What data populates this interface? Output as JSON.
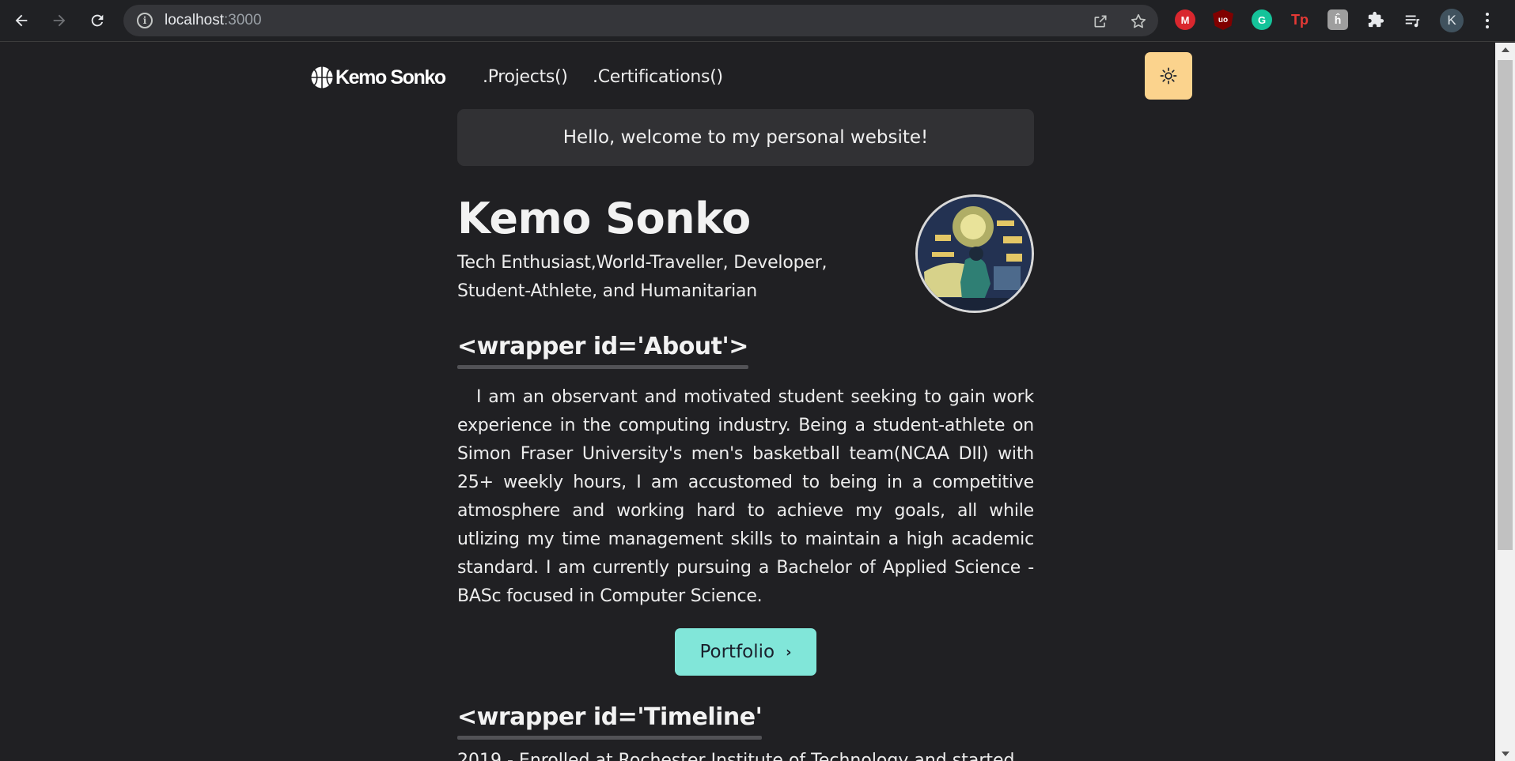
{
  "browser": {
    "url_host": "localhost",
    "url_port": ":3000",
    "profile_initial": "K",
    "extensions": [
      {
        "icon": "mega-icon",
        "label": "M",
        "color": "#d9272e"
      },
      {
        "icon": "ublock-icon",
        "label": "uo",
        "color": "#800000"
      },
      {
        "icon": "grammarly-icon",
        "label": "G",
        "color": "#15c39a"
      },
      {
        "icon": "tp-icon",
        "label": "Tp",
        "color": "#e53935"
      },
      {
        "icon": "lock-extension-icon",
        "label": "ĥ",
        "color": "#9e9e9e"
      }
    ]
  },
  "header": {
    "logo_text": "Kemo Sonko",
    "nav": [
      ".Projects()",
      ".Certifications()"
    ],
    "theme_toggle_color": "#fbd38d"
  },
  "welcome": "Hello, welcome to my personal website!",
  "profile": {
    "name": "Kemo Sonko",
    "tagline": "Tech Enthusiast,World-Traveller, Developer, Student-Athlete, and Humanitarian"
  },
  "about": {
    "heading": "<wrapper id='About'>",
    "body": "I am an observant and motivated student seeking to gain work experience in the computing industry. Being a student-athlete on Simon Fraser University's men's basketball team(NCAA DII) with 25+ weekly hours, I am accustomed to being in a competitive atmosphere and working hard to achieve my goals, all while utlizing my time management skills to maintain a high academic standard. I am currently pursuing a Bachelor of Applied Science - BASc focused in Computer Science.",
    "button_label": "Portfolio",
    "button_color": "#81e6d9"
  },
  "timeline": {
    "heading": "<wrapper id='Timeline'",
    "first_entry_partial": "2019 - Enrolled at Rochester Institute of Technology and started"
  }
}
